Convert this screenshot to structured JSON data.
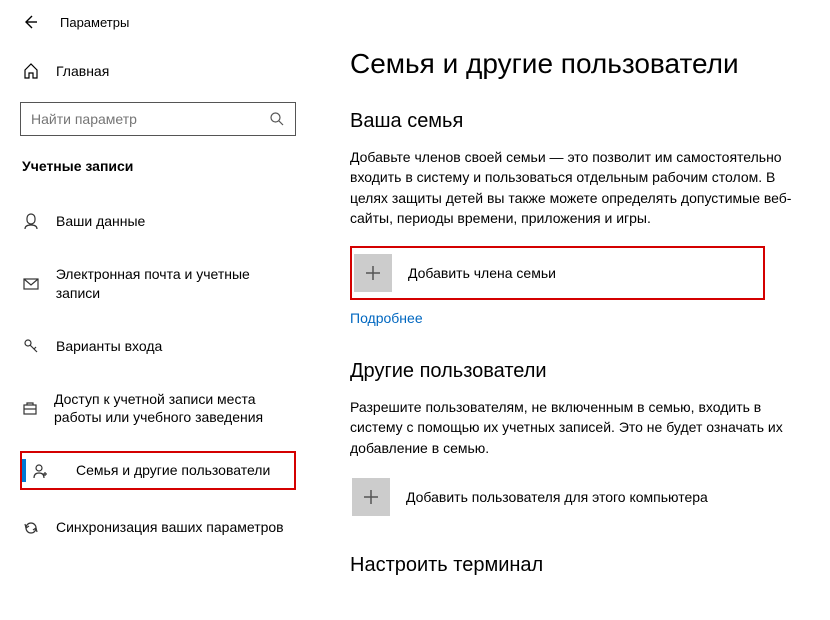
{
  "window": {
    "title": "Параметры"
  },
  "home_label": "Главная",
  "search": {
    "placeholder": "Найти параметр"
  },
  "section_header": "Учетные записи",
  "nav": [
    {
      "label": "Ваши данные"
    },
    {
      "label": "Электронная почта и учетные записи"
    },
    {
      "label": "Варианты входа"
    },
    {
      "label": "Доступ к учетной записи места работы или учебного заведения"
    },
    {
      "label": "Семья и другие пользователи"
    },
    {
      "label": "Синхронизация ваших параметров"
    }
  ],
  "page": {
    "title": "Семья и другие пользователи",
    "family": {
      "heading": "Ваша семья",
      "description": "Добавьте членов своей семьи — это позволит им самостоятельно входить в систему и пользоваться отдельным рабочим столом. В целях защиты детей вы также можете определять допустимые веб-сайты, периоды времени, приложения и игры.",
      "add_label": "Добавить члена семьи",
      "learn_more": "Подробнее"
    },
    "others": {
      "heading": "Другие пользователи",
      "description": "Разрешите пользователям, не включенным в семью, входить в систему с помощью их учетных записей. Это не будет означать их добавление в семью.",
      "add_label": "Добавить пользователя для этого компьютера"
    },
    "terminal": {
      "heading": "Настроить терминал"
    }
  }
}
